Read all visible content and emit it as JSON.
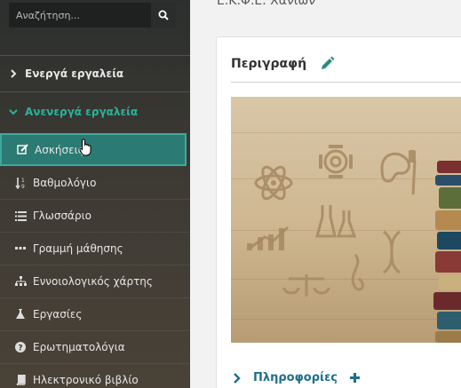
{
  "sidebar": {
    "search": {
      "placeholder": "Αναζήτηση..."
    },
    "sections": {
      "active": "Ενεργά εργαλεία",
      "inactive": "Ανενεργά εργαλεία"
    },
    "items": [
      {
        "label": "Ασκήσεις",
        "icon": "edit-icon"
      },
      {
        "label": "Βαθμολόγιο",
        "icon": "sort-numeric-icon"
      },
      {
        "label": "Γλωσσάριο",
        "icon": "list-icon"
      },
      {
        "label": "Γραμμή μάθησης",
        "icon": "ellipsis-icon"
      },
      {
        "label": "Εννοιολογικός χάρτης",
        "icon": "sitemap-icon"
      },
      {
        "label": "Εργασίες",
        "icon": "flask-icon"
      },
      {
        "label": "Ερωτηματολόγια",
        "icon": "question-circle-icon"
      },
      {
        "label": "Ηλεκτρονικό βιβλίο",
        "icon": "book-icon"
      }
    ]
  },
  "main": {
    "page_title": "Ε.Κ.Φ.Ε. Χανίων",
    "card": {
      "title": "Περιγραφή",
      "info_label": "Πληροφορίες"
    }
  },
  "colors": {
    "sidebar_bg": "#2c2f2d",
    "accent_teal": "#2bb39a",
    "selected_bg": "#2b7a73",
    "link_blue": "#1d6f8a"
  }
}
